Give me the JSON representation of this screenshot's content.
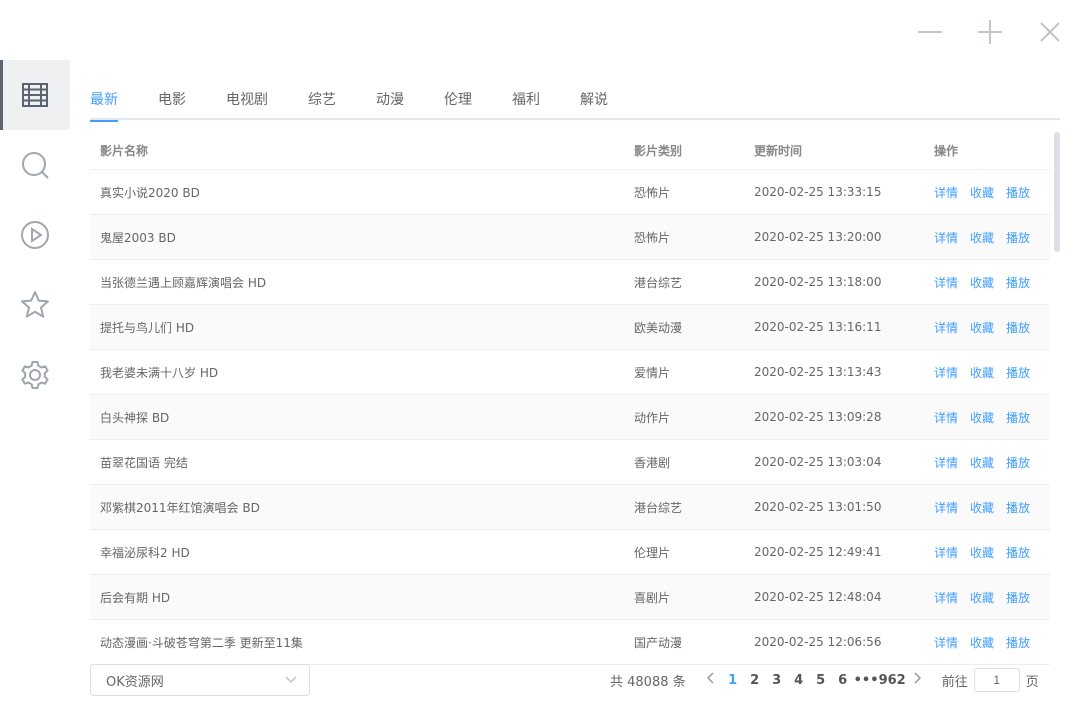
{
  "window": {
    "minimize": "minimize",
    "maximize": "maximize",
    "close": "close"
  },
  "sidebar": {
    "items": [
      {
        "icon": "film-grid-icon",
        "active": true
      },
      {
        "icon": "search-icon",
        "active": false
      },
      {
        "icon": "play-circle-icon",
        "active": false
      },
      {
        "icon": "star-icon",
        "active": false
      },
      {
        "icon": "gear-icon",
        "active": false
      }
    ]
  },
  "tabs": [
    "最新",
    "电影",
    "电视剧",
    "综艺",
    "动漫",
    "伦理",
    "福利",
    "解说"
  ],
  "table": {
    "headers": {
      "name": "影片名称",
      "type": "影片类别",
      "time": "更新时间",
      "ops": "操作"
    },
    "ops": {
      "detail": "详情",
      "fav": "收藏",
      "play": "播放"
    },
    "rows": [
      {
        "name": "真实小说2020 BD",
        "type": "恐怖片",
        "time": "2020-02-25 13:33:15"
      },
      {
        "name": "鬼屋2003 BD",
        "type": "恐怖片",
        "time": "2020-02-25 13:20:00"
      },
      {
        "name": "当张德兰遇上顾嘉辉演唱会 HD",
        "type": "港台综艺",
        "time": "2020-02-25 13:18:00"
      },
      {
        "name": "提托与鸟儿们 HD",
        "type": "欧美动漫",
        "time": "2020-02-25 13:16:11"
      },
      {
        "name": "我老婆未满十八岁 HD",
        "type": "爱情片",
        "time": "2020-02-25 13:13:43"
      },
      {
        "name": "白头神探 BD",
        "type": "动作片",
        "time": "2020-02-25 13:09:28"
      },
      {
        "name": "苗翠花国语 完结",
        "type": "香港剧",
        "time": "2020-02-25 13:03:04"
      },
      {
        "name": "邓紫棋2011年红馆演唱会 BD",
        "type": "港台综艺",
        "time": "2020-02-25 13:01:50"
      },
      {
        "name": "幸福泌尿科2 HD",
        "type": "伦理片",
        "time": "2020-02-25 12:49:41"
      },
      {
        "name": "后会有期 HD",
        "type": "喜剧片",
        "time": "2020-02-25 12:48:04"
      },
      {
        "name": "动态漫画·斗破苍穹第二季 更新至11集",
        "type": "国产动漫",
        "time": "2020-02-25 12:06:56"
      }
    ]
  },
  "footer": {
    "source": "OK资源网",
    "total": "共 48088 条",
    "pages": [
      "1",
      "2",
      "3",
      "4",
      "5",
      "6",
      "•••",
      "962"
    ],
    "jump_prefix": "前往",
    "jump_value": "1",
    "jump_suffix": "页"
  },
  "colors": {
    "accent": "#409eff",
    "icon": "#a0a6ad"
  }
}
